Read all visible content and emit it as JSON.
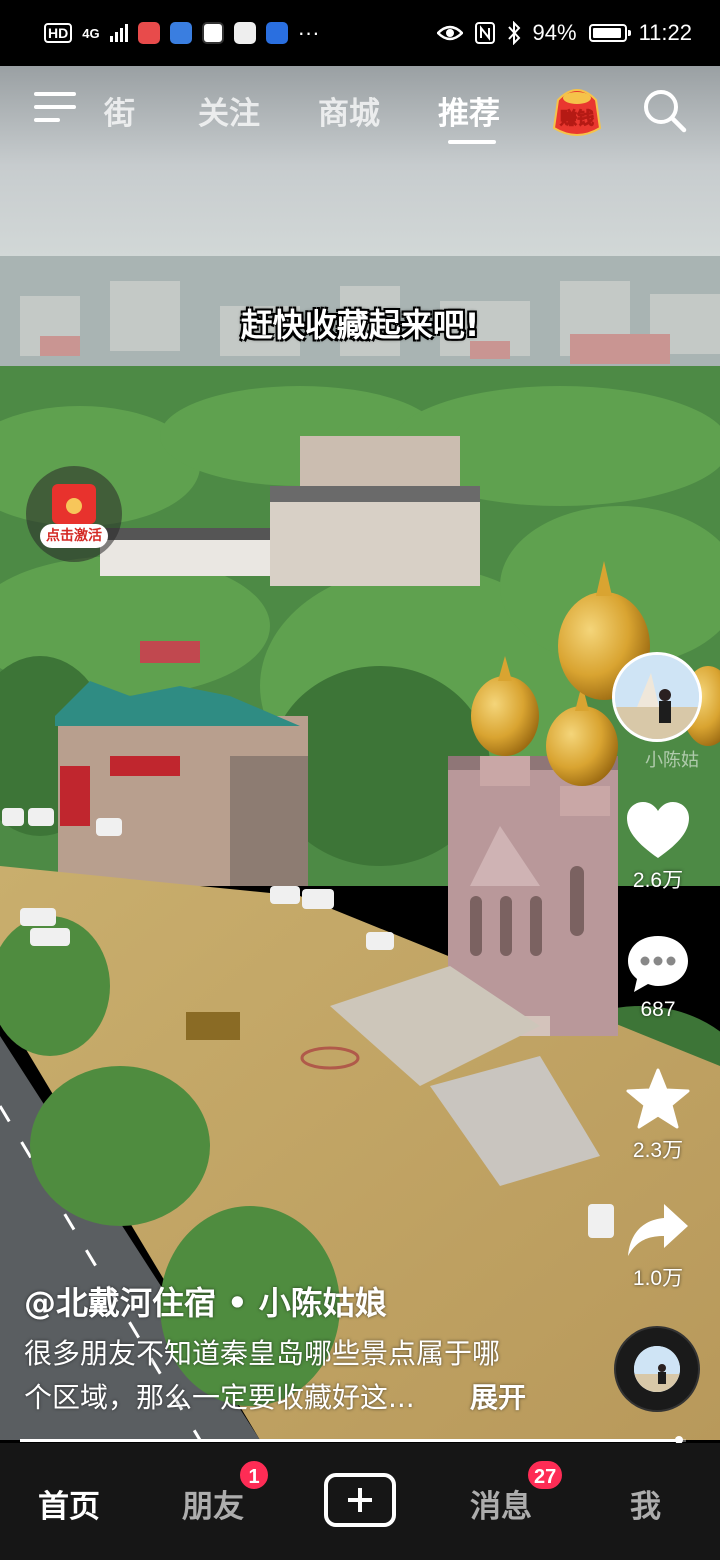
{
  "status_bar": {
    "network": "4G",
    "battery": "94%",
    "time": "11:22",
    "more": "···"
  },
  "top_nav": {
    "tabs": [
      "街",
      "关注",
      "商城",
      "推荐"
    ],
    "active_tab": "推荐",
    "earn_label": "赚钱"
  },
  "video": {
    "overlay_caption": "赶快收藏起来吧!",
    "watermark": "小陈姑"
  },
  "red_packet": {
    "label": "点击激活"
  },
  "actions": {
    "likes": "2.6万",
    "comments": "687",
    "favorites": "2.3万",
    "shares": "1.0万"
  },
  "post": {
    "author": "@北戴河住宿 • 小陈姑娘",
    "description_line1": "很多朋友不知道秦皇岛哪些景点属于哪",
    "description_line2": "个区域，那么一定要收藏好这...",
    "expand_label": "展开",
    "progress_fraction": 0.99
  },
  "bottom_tabs": {
    "home": "首页",
    "friends": "朋友",
    "friends_badge": "1",
    "messages": "消息",
    "messages_badge": "27",
    "me": "我"
  },
  "colors": {
    "badge": "#fe2c55",
    "tab_bar_bg": "#161616",
    "gold_dome": "#d9a431"
  }
}
